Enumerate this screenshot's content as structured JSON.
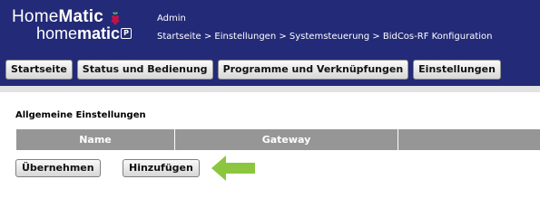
{
  "logo": {
    "line1_light": "Home",
    "line1_bold": "Matic",
    "line2_light": "home",
    "line2_bold": "matic",
    "box_glyph": "P"
  },
  "user": "Admin",
  "breadcrumb": "Startseite > Einstellungen > Systemsteuerung > BidCos-RF Konfiguration",
  "nav": [
    {
      "label": "Startseite"
    },
    {
      "label": "Status und Bedienung"
    },
    {
      "label": "Programme und Verknüpfungen"
    },
    {
      "label": "Einstellungen"
    }
  ],
  "section": {
    "title": "Allgemeine Einstellungen"
  },
  "table": {
    "columns": [
      "Name",
      "Gateway",
      ""
    ]
  },
  "actions": {
    "apply": "Übernehmen",
    "add": "Hinzufügen"
  },
  "colors": {
    "header_bg": "#232a77",
    "table_head_bg": "#969696",
    "arrow": "#8cc63f"
  },
  "icons": {
    "raspberry": "raspberry-pi-icon",
    "arrow": "green-arrow-left-icon"
  }
}
